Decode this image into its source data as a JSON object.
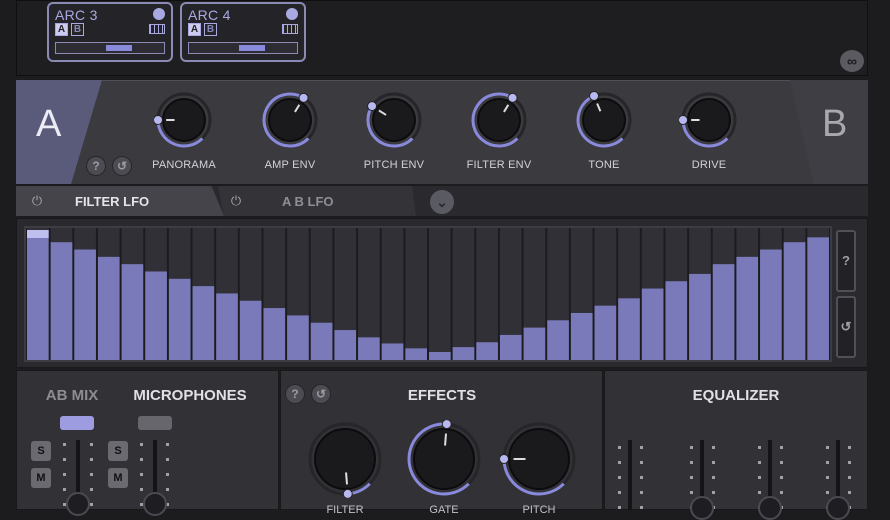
{
  "arc_cards": [
    {
      "title": "ARC 3",
      "a": "A",
      "b": "B",
      "slider_value": 0.55
    },
    {
      "title": "ARC 4",
      "a": "A",
      "b": "B",
      "slider_value": 0.55
    }
  ],
  "tabs": {
    "a": "A",
    "b": "B"
  },
  "knob_controls": {
    "help": "?",
    "reset": "↺",
    "knobs": [
      {
        "label": "PANORAMA",
        "value": 0.5
      },
      {
        "label": "AMP ENV",
        "value": 0.95
      },
      {
        "label": "PITCH ENV",
        "value": 0.62
      },
      {
        "label": "FILTER ENV",
        "value": 0.95
      },
      {
        "label": "TONE",
        "value": 0.75
      },
      {
        "label": "DRIVE",
        "value": 0.5
      }
    ]
  },
  "lfo": {
    "tab1": "FILTER LFO",
    "tab2": "A B LFO",
    "expand_icon": "⌄",
    "power_icon": "⏻",
    "help": "?",
    "reset": "↺",
    "steps": [
      1.0,
      0.9,
      0.84,
      0.78,
      0.72,
      0.66,
      0.6,
      0.54,
      0.48,
      0.42,
      0.36,
      0.3,
      0.24,
      0.18,
      0.12,
      0.07,
      0.03,
      0.0,
      0.04,
      0.08,
      0.14,
      0.2,
      0.26,
      0.32,
      0.38,
      0.44,
      0.52,
      0.58,
      0.64,
      0.72,
      0.78,
      0.84,
      0.9,
      0.94
    ]
  },
  "mixer": {
    "ab_mix": "AB MIX",
    "microphones": "MICROPHONES",
    "solo": "S",
    "mute": "M"
  },
  "effects": {
    "title": "EFFECTS",
    "help": "?",
    "reset": "↺",
    "knobs": [
      {
        "label": "FILTER",
        "value": 0.15
      },
      {
        "label": "GATE",
        "value": 0.85
      },
      {
        "label": "PITCH",
        "value": 0.5
      }
    ]
  },
  "equalizer": {
    "title": "EQUALIZER"
  },
  "colors": {
    "accent": "#8a8adc",
    "panel": "#3a3a3f",
    "background": "#1c1c1e"
  }
}
